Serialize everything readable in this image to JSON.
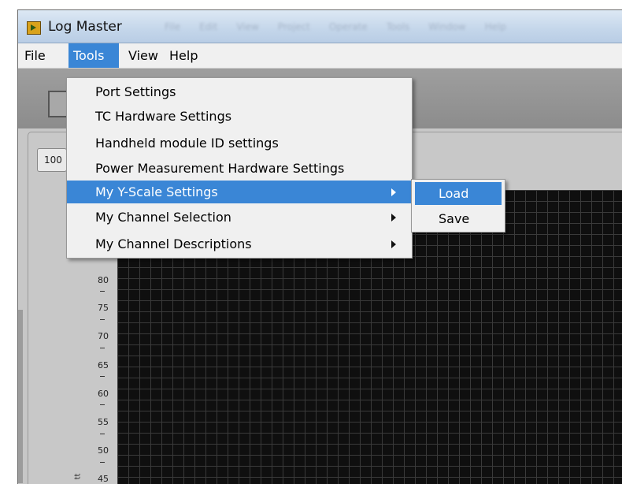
{
  "window": {
    "title": "Log Master",
    "ghost_menu": [
      "File",
      "Edit",
      "View",
      "Project",
      "Operate",
      "Tools",
      "Window",
      "Help"
    ]
  },
  "menubar": {
    "items": [
      {
        "label": "File"
      },
      {
        "label": "Tools"
      },
      {
        "label": "View"
      },
      {
        "label": "Help"
      }
    ]
  },
  "tab": {
    "label": "100"
  },
  "tools_menu": {
    "items": [
      {
        "label": "Port Settings"
      },
      {
        "label": "TC Hardware Settings"
      },
      {
        "label": "Handheld module  ID settings"
      },
      {
        "label": "Power Measurement Hardware Settings"
      },
      {
        "label": "My Y-Scale Settings"
      },
      {
        "label": "My Channel Selection"
      },
      {
        "label": "My Channel Descriptions"
      }
    ]
  },
  "yscale_submenu": {
    "items": [
      {
        "label": "Load"
      },
      {
        "label": "Save"
      }
    ]
  },
  "chart": {
    "y_ticks": [
      "80",
      "75",
      "70",
      "65",
      "60",
      "55",
      "50",
      "45"
    ],
    "y_label_fragment": "tt"
  },
  "colors": {
    "accent": "#3a86d6",
    "plot_background": "#0f0f0f",
    "grid": "#3a3a3a"
  }
}
